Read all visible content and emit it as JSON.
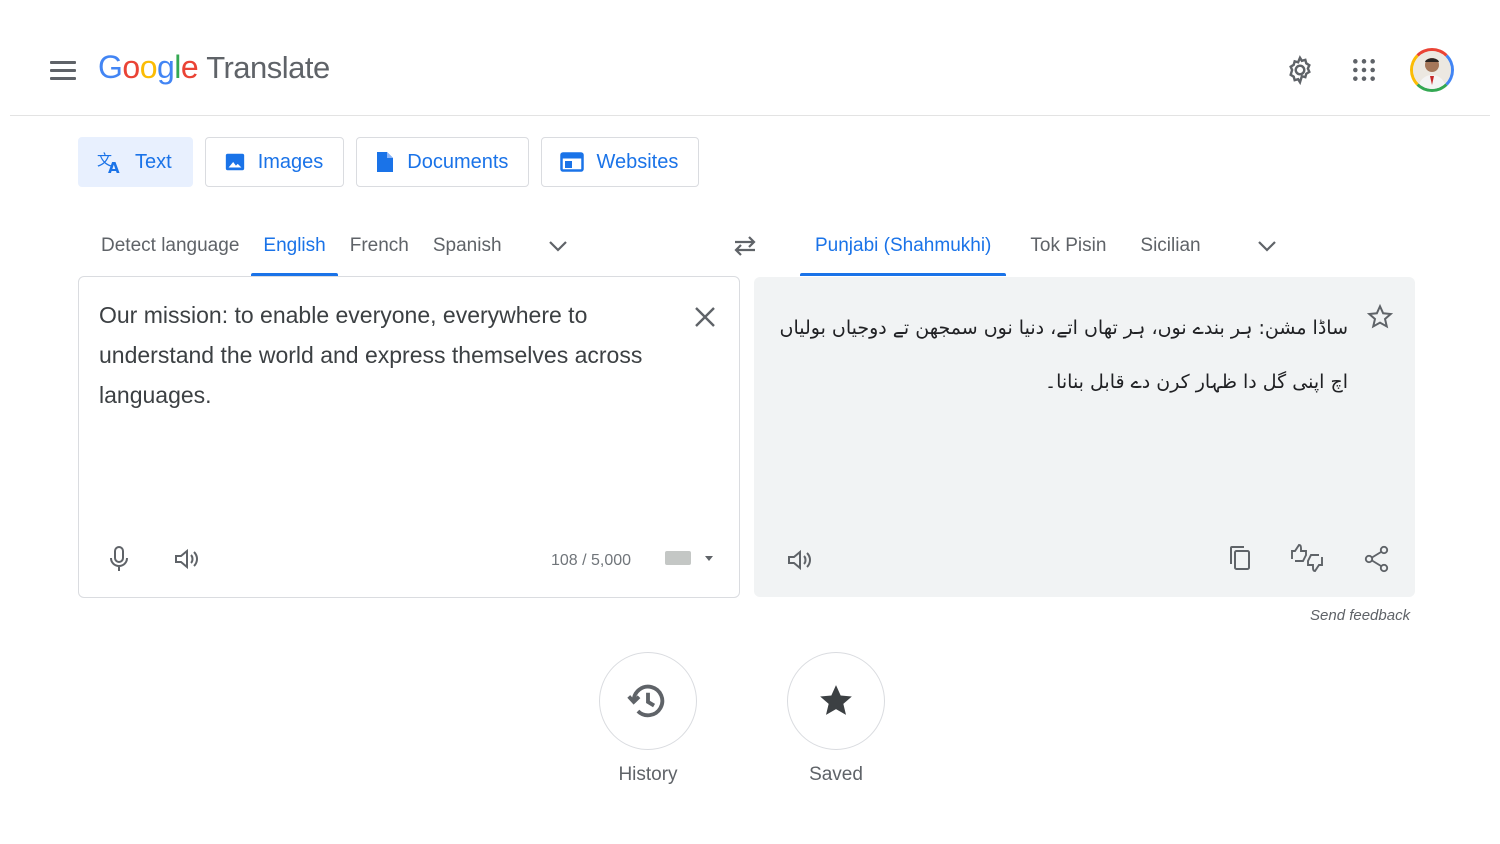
{
  "header": {
    "logo_letters": [
      "G",
      "o",
      "o",
      "g",
      "l",
      "e"
    ],
    "product_name": "Translate",
    "icons": [
      "menu-icon",
      "settings-icon",
      "apps-grid-icon",
      "account-avatar"
    ]
  },
  "mode_tabs": [
    {
      "label": "Text",
      "icon": "translate-icon",
      "active": true
    },
    {
      "label": "Images",
      "icon": "image-icon",
      "active": false
    },
    {
      "label": "Documents",
      "icon": "document-icon",
      "active": false
    },
    {
      "label": "Websites",
      "icon": "website-icon",
      "active": false
    }
  ],
  "source_languages": {
    "items": [
      "Detect language",
      "English",
      "French",
      "Spanish"
    ],
    "selected": "English"
  },
  "target_languages": {
    "items": [
      "Punjabi (Shahmukhi)",
      "Tok Pisin",
      "Sicilian"
    ],
    "selected": "Punjabi (Shahmukhi)"
  },
  "source": {
    "text": "Our mission: to enable everyone, everywhere to understand the world and express themselves across languages.",
    "char_count": "108 / 5,000"
  },
  "target": {
    "text": "ساڈا مشن: ہر بندے نوں، ہر تھاں اتے، دنیا نوں سمجھن تے دوجیاں بولیاں اچ اپنی گل دا ظہار کرن دے قابل بنانا۔"
  },
  "feedback_label": "Send feedback",
  "bottom_actions": [
    {
      "label": "History",
      "icon": "history-icon"
    },
    {
      "label": "Saved",
      "icon": "star-filled-icon"
    }
  ],
  "colors": {
    "accent": "#1a73e8",
    "active_tab_bg": "#e8f0fe",
    "target_panel_bg": "#f1f3f4",
    "border": "#dadce0",
    "icon": "#5f6368"
  }
}
